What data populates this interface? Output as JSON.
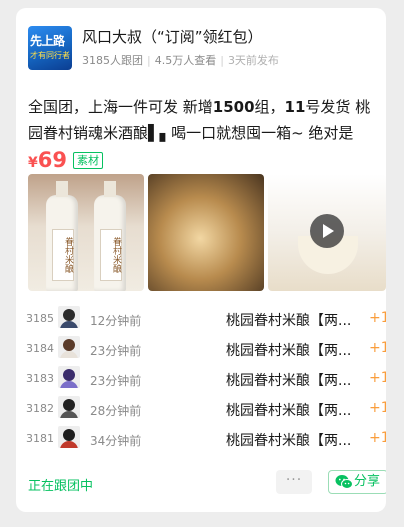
{
  "header": {
    "logo_line1": "先上路",
    "logo_line2": "才有同行者",
    "title": "风口大叔（“订阅”领红包）",
    "followers": "3185人跟团",
    "views": "4.5万人查看",
    "published": "3天前发布"
  },
  "post": {
    "desc_a": "全国团，上海一件可发 新增",
    "desc_b": "1500",
    "desc_c": "组，",
    "desc_d": "11",
    "desc_e": "号发货 桃园眷村销魂米酒酿▌▖喝一口就想囤一箱~ 绝对是灵...",
    "price_symbol": "¥",
    "price": "69",
    "tag": "素材",
    "bottle_label": "眷村米酿"
  },
  "orders": [
    {
      "num": "3185",
      "ago": "12分钟前",
      "product": "桃园眷村米酿【两...",
      "qty": "+1",
      "hair": "#2b2b2b",
      "shirt": "#3a4a6b"
    },
    {
      "num": "3184",
      "ago": "23分钟前",
      "product": "桃园眷村米酿【两...",
      "qty": "+1",
      "hair": "#5a3b2a",
      "shirt": "#e8e2da"
    },
    {
      "num": "3183",
      "ago": "23分钟前",
      "product": "桃园眷村米酿【两...",
      "qty": "+1",
      "hair": "#3a2c6b",
      "shirt": "#7b6fc9"
    },
    {
      "num": "3182",
      "ago": "28分钟前",
      "product": "桃园眷村米酿【两...",
      "qty": "+1",
      "hair": "#222222",
      "shirt": "#555555"
    },
    {
      "num": "3181",
      "ago": "34分钟前",
      "product": "桃园眷村米酿【两...",
      "qty": "+1",
      "hair": "#1e1e1e",
      "shirt": "#c0392b"
    }
  ],
  "footer": {
    "status": "正在跟团中",
    "more_label": "···",
    "share_label": "分享"
  },
  "colors": {
    "accent_green": "#07c160",
    "price_red": "#fa5151",
    "qty_orange": "#fa9d3b"
  }
}
